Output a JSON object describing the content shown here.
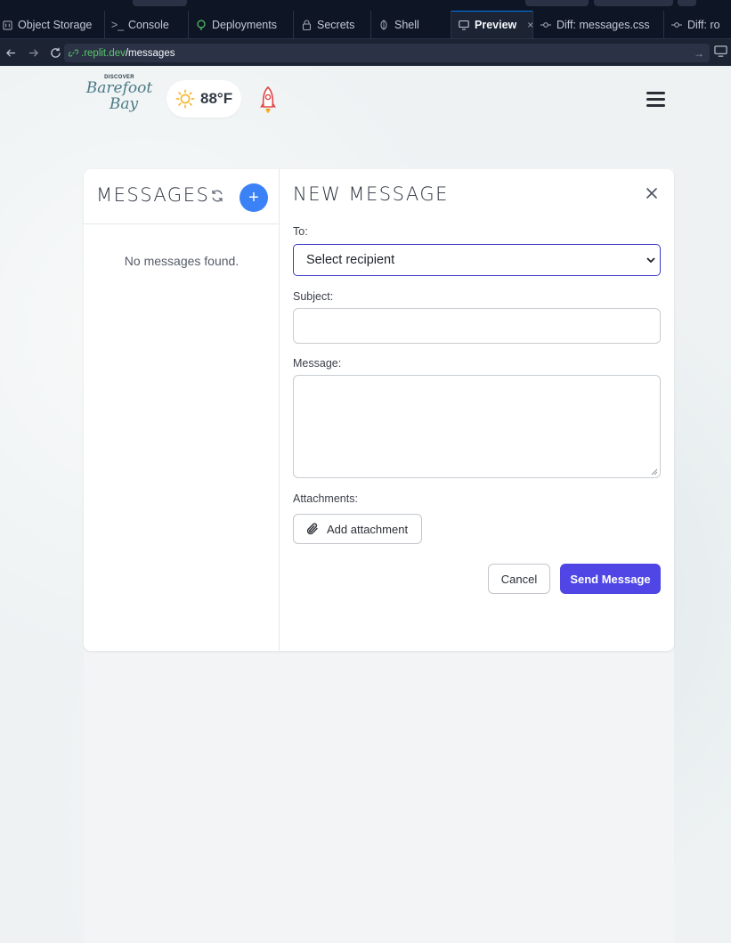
{
  "ide": {
    "tabs": [
      {
        "label": "Object Storage",
        "icon": "object-storage-icon"
      },
      {
        "label": "Console",
        "icon": "console-icon"
      },
      {
        "label": "Deployments",
        "icon": "deployments-icon"
      },
      {
        "label": "Secrets",
        "icon": "lock-icon"
      },
      {
        "label": "Shell",
        "icon": "shell-icon"
      },
      {
        "label": "Preview",
        "icon": "monitor-icon",
        "active": true
      },
      {
        "label": "Diff: messages.css",
        "icon": "diff-icon"
      },
      {
        "label": "Diff: ro",
        "icon": "diff-icon"
      }
    ],
    "url": {
      "domain": ".replit.dev",
      "path": "/messages"
    },
    "accent": "#0079f2"
  },
  "site": {
    "logo": {
      "top": "DISCOVER",
      "line1": "Barefoot",
      "line2": "Bay"
    },
    "weather": {
      "icon": "sun-icon",
      "temperature": "88°F"
    },
    "menu_icon": "hamburger-icon"
  },
  "messages": {
    "title": "MESSAGES",
    "add_label": "+",
    "empty_text": "No messages found."
  },
  "compose": {
    "title": "NEW MESSAGE",
    "to_label": "To:",
    "recipient_selected": "Select recipient",
    "subject_label": "Subject:",
    "subject_value": "",
    "message_label": "Message:",
    "message_value": "",
    "attachments_label": "Attachments:",
    "add_attachment_label": "Add attachment",
    "cancel_label": "Cancel",
    "send_label": "Send Message",
    "send_color": "#4f46e5",
    "add_button_color": "#3b82f6"
  }
}
